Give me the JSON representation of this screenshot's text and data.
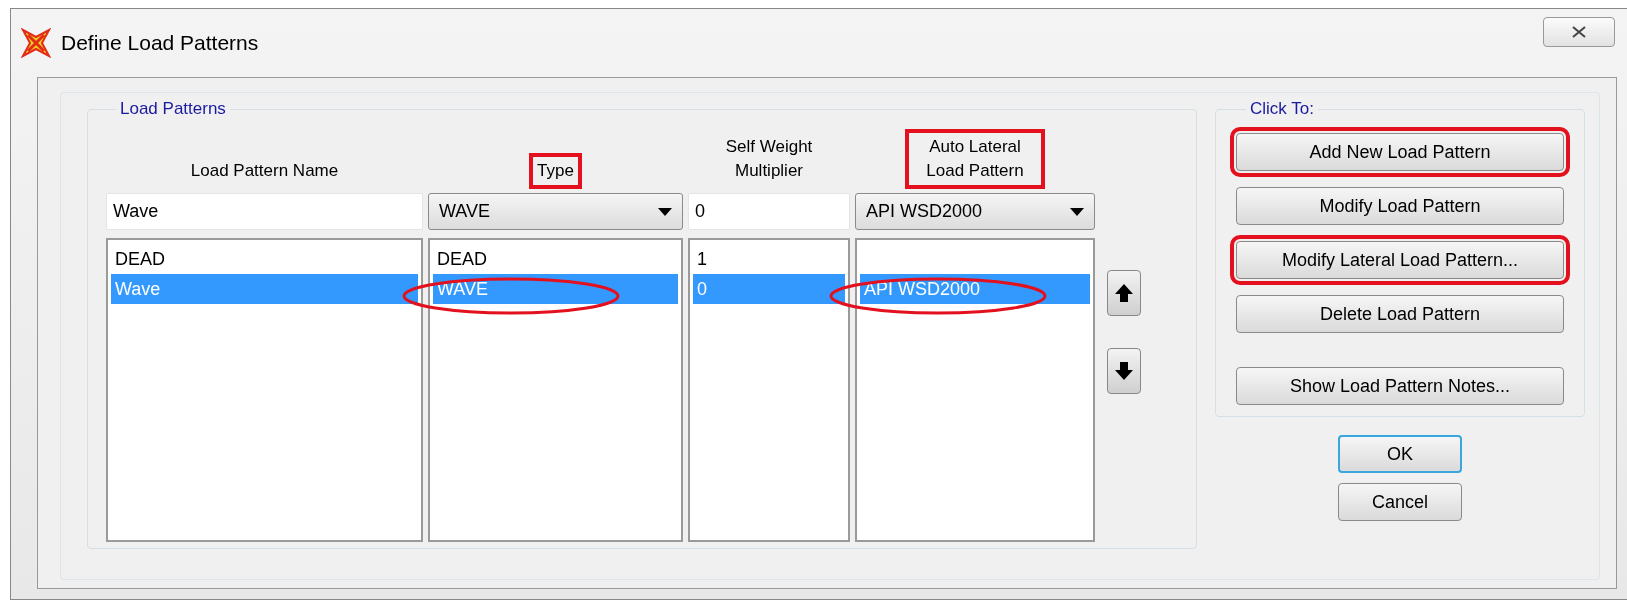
{
  "window": {
    "title": "Define Load Patterns"
  },
  "load_patterns": {
    "title": "Load Patterns",
    "columns": [
      {
        "header": "Load Pattern Name",
        "annotated": false,
        "kind": "text",
        "value": "Wave"
      },
      {
        "header": "Type",
        "annotated": true,
        "kind": "dropdown",
        "value": "WAVE"
      },
      {
        "header": "Self Weight Multiplier",
        "annotated": false,
        "kind": "text",
        "value": "0"
      },
      {
        "header": "Auto Lateral Load Pattern",
        "annotated": true,
        "kind": "dropdown",
        "value": "API WSD2000"
      }
    ],
    "rows": [
      {
        "selected": false,
        "cells": [
          {
            "text": "DEAD",
            "circled": false
          },
          {
            "text": "DEAD",
            "circled": false
          },
          {
            "text": "1",
            "circled": false
          }
        ]
      },
      {
        "selected": true,
        "cells": [
          {
            "text": "Wave",
            "circled": false
          },
          {
            "text": "WAVE",
            "circled": true
          },
          {
            "text": "0",
            "circled": false
          },
          {
            "text": "API WSD2000",
            "circled": true
          }
        ]
      }
    ]
  },
  "click_to": {
    "title": "Click To:",
    "buttons": [
      {
        "label": "Add New Load Pattern",
        "annotated": true
      },
      {
        "label": "Modify Load Pattern",
        "annotated": false
      },
      {
        "label": "Modify Lateral Load Pattern...",
        "annotated": true
      },
      {
        "label": "Delete Load Pattern",
        "annotated": false
      },
      {
        "label": "Show Load Pattern Notes...",
        "annotated": false
      }
    ]
  },
  "dialog_buttons": [
    {
      "label": "OK",
      "default": true
    },
    {
      "label": "Cancel",
      "default": false
    }
  ]
}
